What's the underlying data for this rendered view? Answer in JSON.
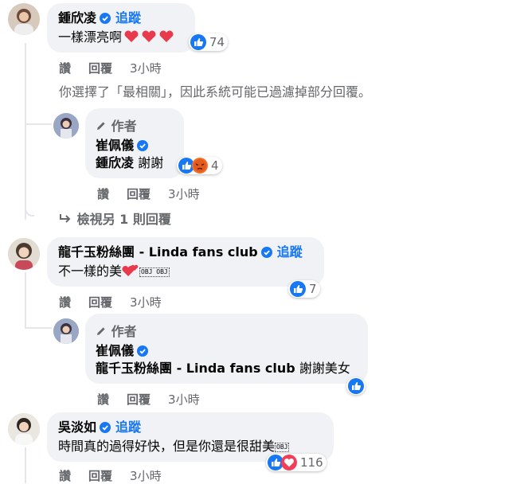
{
  "comments": [
    {
      "name": "鍾欣凌",
      "follow": "追蹤",
      "text": "一樣漂亮啊",
      "reaction_count": "74",
      "actions": {
        "like": "讚",
        "reply": "回覆",
        "time": "3小時"
      }
    },
    {
      "name": "龍千玉粉絲團 - Linda fans club",
      "follow": "追蹤",
      "text": "不一樣的美",
      "obj_marks": "OBJ OBJ",
      "reaction_count": "7",
      "actions": {
        "like": "讚",
        "reply": "回覆",
        "time": "3小時"
      }
    },
    {
      "name": "吳淡如",
      "follow": "追蹤",
      "text": "時間真的過得好快，但是你還是很甜美",
      "obj_marks": "OBJ",
      "reaction_count": "116",
      "actions": {
        "like": "讚",
        "reply": "回覆",
        "time": "3小時"
      }
    }
  ],
  "filter_notice": "你選擇了「最相關」，因此系統可能已過濾掉部分回覆。",
  "replies": [
    {
      "author_tag": "作者",
      "name": "崔佩儀",
      "mention": "鍾欣凌",
      "text": "謝謝",
      "reaction_count": "4",
      "actions": {
        "like": "讚",
        "reply": "回覆",
        "time": "3小時"
      }
    },
    {
      "author_tag": "作者",
      "name": "崔佩儀",
      "mention": "龍千玉粉絲團 - Linda fans club",
      "text": "謝謝美女",
      "actions": {
        "like": "讚",
        "reply": "回覆",
        "time": "3小時"
      }
    }
  ],
  "view_more": "檢視另 1 則回覆",
  "colors": {
    "link": "#1877f2",
    "bubble": "#f0f2f5",
    "meta": "#65676b",
    "love": "#f33e58",
    "like": "#1877f2"
  }
}
